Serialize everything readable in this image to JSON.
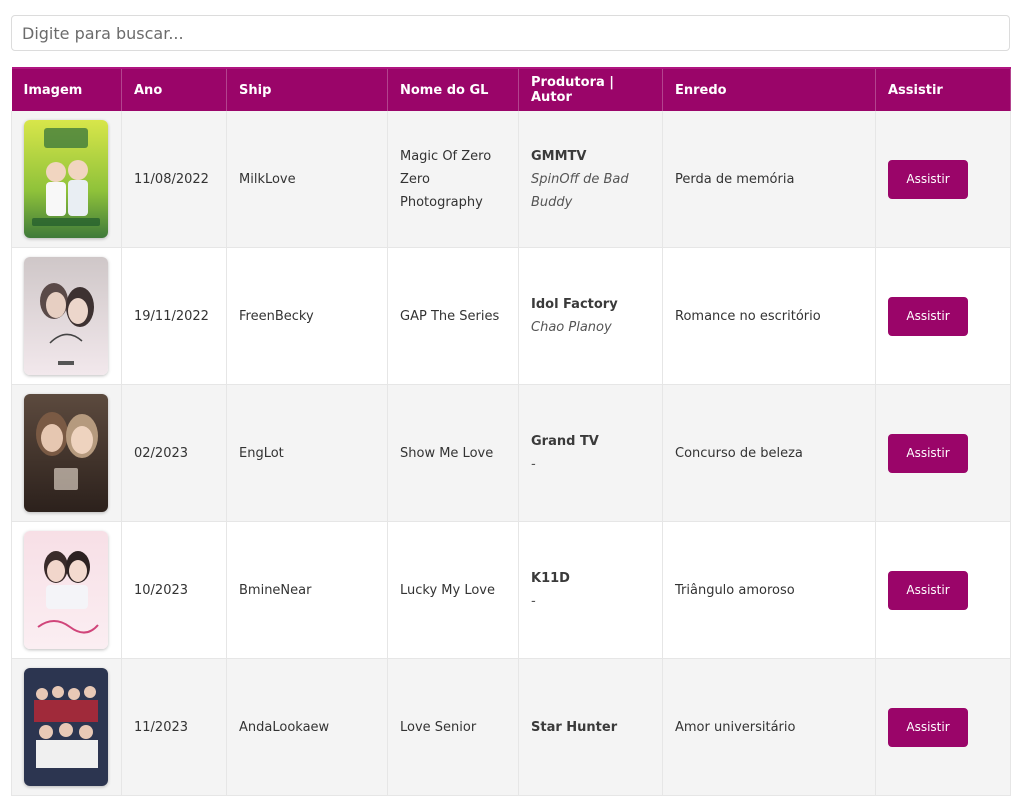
{
  "search": {
    "placeholder": "Digite para buscar..."
  },
  "colors": {
    "accent": "#9a0569",
    "row_alt": "#f4f4f4"
  },
  "table": {
    "headers": [
      "Imagem",
      "Ano",
      "Ship",
      "Nome do GL",
      "Produtora | Autor",
      "Enredo",
      "Assistir"
    ],
    "rows": [
      {
        "image_icon": "poster-magic-of-zero",
        "ano": "11/08/2022",
        "ship": "MilkLove",
        "nome": "Magic Of Zero Zero Photography",
        "produtora": "GMMTV",
        "autor": "SpinOff de Bad Buddy",
        "enredo": "Perda de memória",
        "assistir": "Assistir"
      },
      {
        "image_icon": "poster-gap-the-series",
        "ano": "19/11/2022",
        "ship": "FreenBecky",
        "nome": "GAP The Series",
        "produtora": "Idol Factory",
        "autor": "Chao Planoy",
        "enredo": "Romance no escritório",
        "assistir": "Assistir"
      },
      {
        "image_icon": "poster-show-me-love",
        "ano": "02/2023",
        "ship": "EngLot",
        "nome": "Show Me Love",
        "produtora": "Grand TV",
        "autor": "-",
        "enredo": "Concurso de beleza",
        "assistir": "Assistir"
      },
      {
        "image_icon": "poster-lucky-my-love",
        "ano": "10/2023",
        "ship": "BmineNear",
        "nome": "Lucky My Love",
        "produtora": "K11D",
        "autor": "-",
        "enredo": "Triângulo amoroso",
        "assistir": "Assistir"
      },
      {
        "image_icon": "poster-love-senior",
        "ano": "11/2023",
        "ship": "AndaLookaew",
        "nome": "Love Senior",
        "produtora": "Star Hunter",
        "autor": "",
        "enredo": "Amor universitário",
        "assistir": "Assistir"
      }
    ]
  }
}
